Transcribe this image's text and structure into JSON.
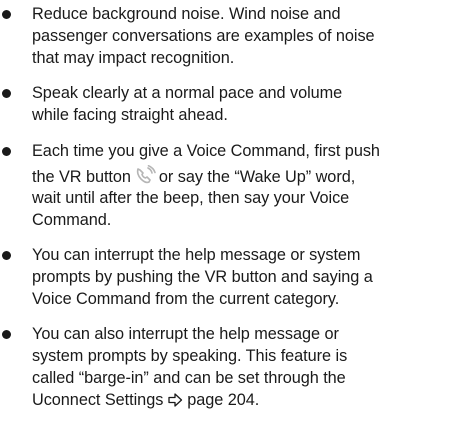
{
  "bullets": [
    {
      "lines": [
        "Reduce background noise. Wind noise and",
        "passenger conversations are examples of noise",
        "that may impact recognition."
      ]
    },
    {
      "lines": [
        "Speak clearly at a normal pace and volume",
        "while facing straight ahead."
      ]
    },
    {
      "lines": [
        "Each time you give a Voice Command, first push",
        "the VR button",
        "or say the “Wake Up” word,",
        "wait until after the beep, then say your Voice",
        "Command."
      ],
      "icon": "voice-recognition-icon"
    },
    {
      "lines": [
        "You can interrupt the help message or system",
        "prompts by pushing the VR button and saying a",
        "Voice Command from the current category."
      ]
    },
    {
      "lines": [
        "You can also interrupt the help message or",
        "system prompts by speaking. This feature is",
        "called “barge-in” and can be set through the",
        "Uconnect Settings",
        "page 204."
      ],
      "icon": "page-reference-arrow-icon"
    }
  ],
  "colors": {
    "text": "#1a1a1a",
    "icon": "#b5b5b5"
  }
}
